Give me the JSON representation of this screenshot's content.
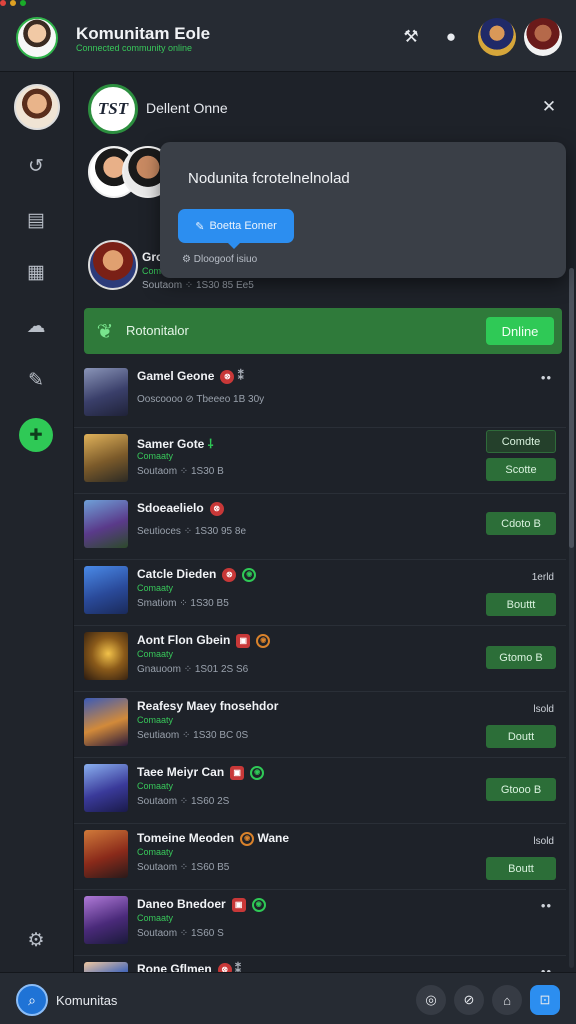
{
  "window": {
    "light_colors": [
      "#e0443e",
      "#dea123",
      "#1aab29"
    ]
  },
  "header": {
    "title": "Komunitam Eole",
    "subtitle": "Connected community online",
    "icons": [
      "hammer-icon",
      "gamepad-icon"
    ]
  },
  "rail": {
    "icons": [
      "refresh-icon",
      "calendar-icon",
      "layout-icon",
      "cloud-icon",
      "edit-icon",
      "game-controller-icon",
      "settings-icon"
    ]
  },
  "panel": {
    "logo_text": "TST",
    "title": "Dellent Onne",
    "close_glyph": "✕"
  },
  "popover": {
    "text": "Nodunita fcrotelnelnolad",
    "button_label": "Boetta Eomer",
    "meta": "Dloogoof isiuo"
  },
  "peek": {
    "name": "Gro",
    "status": "Comanaty",
    "meta": "Soutaom  ⁘ 1S30  85 Ee5"
  },
  "banner": {
    "text": "Rotonitalor",
    "button_label": "Dnline"
  },
  "items": [
    {
      "name": "Gamel Geone",
      "badge": "red",
      "extra": "⁑",
      "status": "",
      "meta": "Ooscoooo  ⊘ Tbeeeo 1B 30y",
      "right": "",
      "button": "",
      "dots": "••"
    },
    {
      "name": "Samer Gote",
      "badge": "none",
      "extra": "⸸",
      "status": "Comaaty",
      "meta": "Soutaom  ⁘ 1S30  B",
      "right": "",
      "button": "Scotte",
      "button2": "Comdte",
      "dots": ""
    },
    {
      "name": "Sdoeaelielo",
      "badge": "red",
      "extra": "",
      "status": "",
      "meta": "Seutioces  ⁘ 1S30  95 8e",
      "right": "",
      "button": "Cdoto  B",
      "dots": ""
    },
    {
      "name": "Catcle Dieden",
      "badge": "red",
      "badge2": "green",
      "extra": "",
      "status": "Comaaty",
      "meta": "Smatiom  ⁘ 1S30  B5",
      "right": "1erld",
      "button": "Bouttt",
      "dots": ""
    },
    {
      "name": "Aont Flon Gbein",
      "badge": "red",
      "badge2": "orange",
      "extra": "",
      "status": "Comaaty",
      "meta": "Gnauoom  ⁘ 1S01  2S S6",
      "right": "",
      "button": "Gtomo  B",
      "dots": ""
    },
    {
      "name": "Reafesy Maey fnosehdor",
      "badge": "none",
      "extra": "",
      "status": "Comaaty",
      "meta": "Seutiaom  ⁘ 1S30  BC 0S",
      "right": "lsold",
      "button": "Doutt",
      "dots": ""
    },
    {
      "name": "Taee Meiyr Can",
      "badge": "red",
      "badge2": "green",
      "extra": "",
      "status": "Comaaty",
      "meta": "Soutaom  ⁘ 1S60  2S",
      "right": "",
      "button": "Gtooo  B",
      "dots": ""
    },
    {
      "name": "Tomeine Meoden",
      "badge": "orange",
      "extra": "Wane",
      "status": "Comaaty",
      "meta": "Soutaom  ⁘ 1S60  B5",
      "right": "lsold",
      "button": "Boutt",
      "dots": ""
    },
    {
      "name": "Daneo Bnedoer",
      "badge": "red",
      "badge2": "green",
      "extra": "",
      "status": "Comaaty",
      "meta": "Soutaom  ⁘ 1S60  S",
      "right": "",
      "button": "",
      "dots": "••"
    },
    {
      "name": "Rone Gflmen",
      "badge": "red",
      "extra": "⁑",
      "status": "",
      "meta": "",
      "right": "",
      "button": "",
      "dots": "••"
    }
  ],
  "bottom": {
    "name": "Komunitas"
  },
  "colors": {
    "accent_green": "#2fc956",
    "accent_blue": "#2c8ef0",
    "background": "#1b1f26"
  }
}
